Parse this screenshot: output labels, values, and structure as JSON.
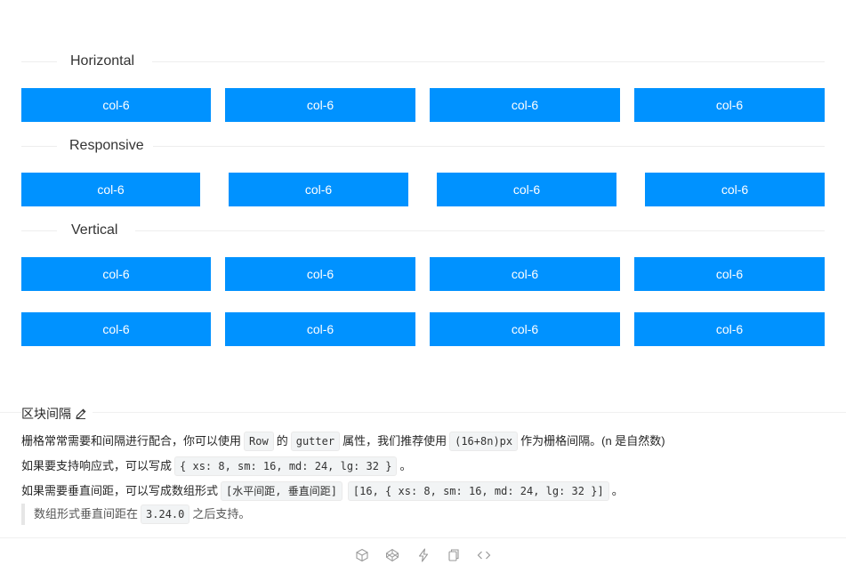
{
  "sections": [
    {
      "label": "Horizontal"
    },
    {
      "label": "Responsive"
    },
    {
      "label": "Vertical"
    }
  ],
  "col_label": "col-6",
  "description": {
    "title": "区块间隔",
    "line1": {
      "t1": "栅格常常需要和间隔进行配合，你可以使用",
      "c1": "Row",
      "t2": "的",
      "c2": "gutter",
      "t3": "属性，我们推荐使用",
      "c3": "(16+8n)px",
      "t4": "作为栅格间隔。(n 是自然数)"
    },
    "line2": {
      "t1": "如果要支持响应式，可以写成",
      "c1": "{ xs: 8, sm: 16, md: 24, lg: 32 }",
      "t2": "。"
    },
    "line3": {
      "t1": "如果需要垂直间距，可以写成数组形式",
      "c1": "[水平间距, 垂直间距]",
      "c2": "[16, { xs: 8, sm: 16, md: 24, lg: 32 }]",
      "t2": "。"
    },
    "note": {
      "t1": "数组形式垂直间距在",
      "c1": "3.24.0",
      "t2": "之后支持。"
    }
  },
  "actions": [
    {
      "icon": "codesandbox-icon"
    },
    {
      "icon": "codepen-icon"
    },
    {
      "icon": "stackblitz-icon"
    },
    {
      "icon": "copy-icon"
    },
    {
      "icon": "expand-code-icon"
    }
  ],
  "colors": {
    "col_bg": "#0092ff",
    "col_text": "#ffffff"
  }
}
